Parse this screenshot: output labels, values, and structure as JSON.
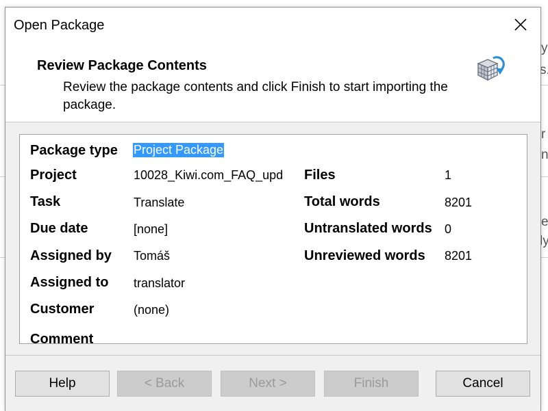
{
  "dialog": {
    "title": "Open Package",
    "close_glyph": "✕"
  },
  "header": {
    "title": "Review Package Contents",
    "description": "Review the package contents and click Finish to start importing the package.",
    "icon": "package-cube-refresh-icon"
  },
  "package": {
    "labels": {
      "package_type": "Package type",
      "project": "Project",
      "task": "Task",
      "due_date": "Due date",
      "assigned_by": "Assigned by",
      "assigned_to": "Assigned to",
      "customer": "Customer",
      "comment": "Comment",
      "files": "Files",
      "total_words": "Total words",
      "untranslated_words": "Untranslated words",
      "unreviewed_words": "Unreviewed words"
    },
    "values": {
      "package_type": "Project Package",
      "project": "10028_Kiwi.com_FAQ_upd",
      "task": "Translate",
      "due_date": "[none]",
      "assigned_by": "Tomáš",
      "assigned_to": "translator",
      "customer": "(none)",
      "files": "1",
      "total_words": "8201",
      "untranslated_words": "0",
      "unreviewed_words": "8201"
    }
  },
  "buttons": {
    "help": "Help",
    "back": "< Back",
    "next": "Next >",
    "finish": "Finish",
    "cancel": "Cancel"
  },
  "background": {
    "fragments": [
      "y",
      "s.",
      "r",
      "n",
      "e",
      "ly"
    ]
  },
  "colors": {
    "selection": "#3399ff",
    "dialog_bg": "#f0f0f0",
    "disabled_text": "#9a9a9a"
  }
}
